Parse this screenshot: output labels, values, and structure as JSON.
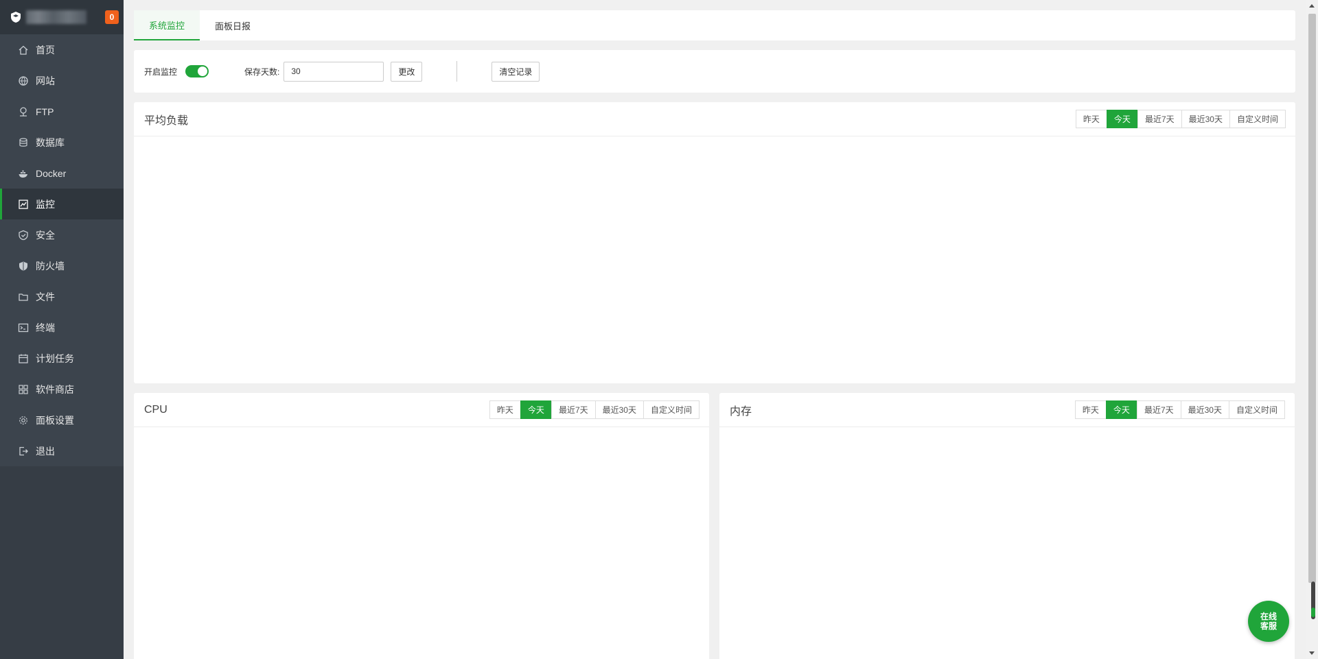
{
  "sidebar": {
    "badge": "0",
    "items": [
      {
        "label": "首页",
        "icon": "home-icon"
      },
      {
        "label": "网站",
        "icon": "globe-icon"
      },
      {
        "label": "FTP",
        "icon": "ftp-icon"
      },
      {
        "label": "数据库",
        "icon": "database-icon"
      },
      {
        "label": "Docker",
        "icon": "docker-icon"
      },
      {
        "label": "监控",
        "icon": "monitor-icon"
      },
      {
        "label": "安全",
        "icon": "shield-check-icon"
      },
      {
        "label": "防火墙",
        "icon": "firewall-shield-icon"
      },
      {
        "label": "文件",
        "icon": "folder-icon"
      },
      {
        "label": "终端",
        "icon": "terminal-icon"
      },
      {
        "label": "计划任务",
        "icon": "calendar-icon"
      },
      {
        "label": "软件商店",
        "icon": "apps-grid-icon"
      },
      {
        "label": "面板设置",
        "icon": "gear-icon"
      },
      {
        "label": "退出",
        "icon": "logout-icon"
      }
    ],
    "active_index": 5
  },
  "tabs": [
    {
      "label": "系统监控",
      "active": true
    },
    {
      "label": "面板日报",
      "active": false
    }
  ],
  "toolbar": {
    "enable_label": "开启监控",
    "enable_on": true,
    "days_label": "保存天数:",
    "days_value": "30",
    "change_label": "更改",
    "clear_label": "清空记录"
  },
  "ranges": [
    "昨天",
    "今天",
    "最近7天",
    "最近30天",
    "自定义时间"
  ],
  "active_range": "今天",
  "charts": {
    "load_title": "平均负载",
    "cpu_title": "CPU",
    "mem_title": "内存"
  },
  "chat": {
    "line1": "在线",
    "line2": "客服"
  },
  "colors": {
    "accent": "#20a53a",
    "sidebar_bg": "#3c444d",
    "badge": "#f0611c"
  }
}
